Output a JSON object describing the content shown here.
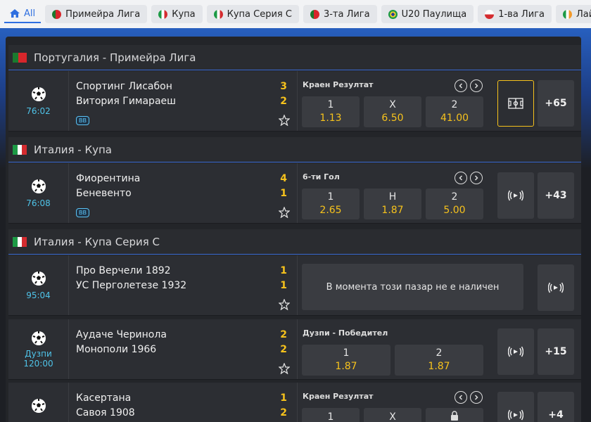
{
  "tabs": [
    {
      "label": "All",
      "flag": "home"
    },
    {
      "label": "Примейра Лига",
      "flag": "pt"
    },
    {
      "label": "Купа",
      "flag": "it"
    },
    {
      "label": "Купа Серия C",
      "flag": "it"
    },
    {
      "label": "3-та Лига",
      "flag": "pt"
    },
    {
      "label": "U20 Паулища",
      "flag": "br"
    },
    {
      "label": "1-ва Лига",
      "flag": "pl"
    },
    {
      "label": "Лайн",
      "flag": "ie"
    }
  ],
  "leagues": [
    {
      "title": "Португалия - Примейра Лига",
      "flag": "pt"
    },
    {
      "title": "Италия - Купа",
      "flag": "it"
    },
    {
      "title": "Италия - Купа Серия C",
      "flag": "it"
    }
  ],
  "matches": [
    {
      "time": "76:02",
      "team1": "Спортинг Лисабон",
      "team2": "Витория Гимараеш",
      "score1": "3",
      "score2": "2",
      "badge": "BB",
      "market": "Краен Резултат",
      "odds": [
        {
          "label": "1",
          "value": "1.13"
        },
        {
          "label": "X",
          "value": "6.50"
        },
        {
          "label": "2",
          "value": "41.00"
        }
      ],
      "more": "+65"
    },
    {
      "time": "76:08",
      "team1": "Фиорентина",
      "team2": "Беневенто",
      "score1": "4",
      "score2": "1",
      "badge": "BB",
      "market": "6-ти Гол",
      "odds": [
        {
          "label": "1",
          "value": "2.65"
        },
        {
          "label": "Н",
          "value": "1.87"
        },
        {
          "label": "2",
          "value": "5.00"
        }
      ],
      "more": "+43"
    },
    {
      "time": "95:04",
      "team1": "Про Верчели 1892",
      "team2": "УС Перголетезе 1932",
      "score1": "1",
      "score2": "1",
      "unavailable": "В момента този пазар не е наличен"
    },
    {
      "status": "Дузпи",
      "time": "120:00",
      "team1": "Аудаче Черинола",
      "team2": "Монополи 1966",
      "score1": "2",
      "score2": "2",
      "market": "Дузпи - Победител",
      "odds": [
        {
          "label": "1",
          "value": "1.87"
        },
        {
          "label": "2",
          "value": "1.87"
        }
      ],
      "more": "+15"
    },
    {
      "team1": "Касертана",
      "team2": "Савоя 1908",
      "score1": "1",
      "score2": "2",
      "market": "Краен Резултат",
      "odds": [
        {
          "label": "1",
          "value": ""
        },
        {
          "label": "X",
          "value": ""
        }
      ],
      "more": "+4"
    }
  ],
  "colors": {
    "accent": "#f6c21c",
    "time": "#4fc3e8",
    "link": "#2f6fe0"
  }
}
